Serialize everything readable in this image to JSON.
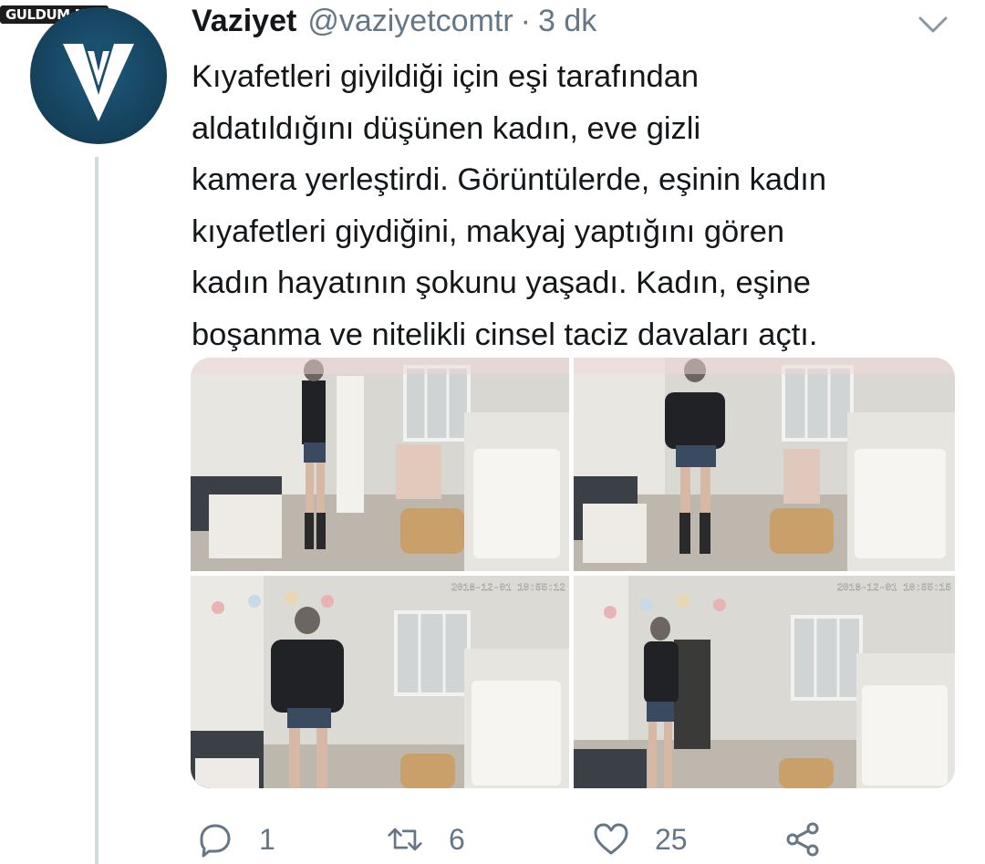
{
  "watermark": "GULDUM.NET",
  "tweet": {
    "display_name": "Vaziyet",
    "handle": "@vaziyetcomtr",
    "separator": "·",
    "time": "3 dk",
    "text_lines": [
      "Kıyafetleri giyildiği için eşi tarafından",
      "aldatıldığını düşünen kadın, eve gizli",
      "kamera yerleştirdi. Görüntülerde, eşinin kadın",
      "kıyafetleri giydiğini, makyaj yaptığını gören",
      "kadın hayatının şokunu yaşadı. Kadın, eşine",
      "boşanma ve nitelikli cinsel taciz davaları açtı."
    ],
    "photos": [
      {
        "timestamp": ""
      },
      {
        "timestamp": ""
      },
      {
        "timestamp": "2018-12-01 10:55:12"
      },
      {
        "timestamp": "2018-12-01 10:55:15"
      }
    ],
    "actions": {
      "reply_count": "1",
      "retweet_count": "6",
      "like_count": "25"
    }
  },
  "icons": {
    "avatar": "vaziyet-logo-icon",
    "menu": "chevron-down-icon",
    "reply": "reply-icon",
    "retweet": "retweet-icon",
    "like": "heart-icon",
    "share": "share-icon"
  },
  "colors": {
    "text": "#14171a",
    "secondary": "#657786",
    "avatar_bg": "#143f59",
    "thread_line": "#cfd9de"
  }
}
